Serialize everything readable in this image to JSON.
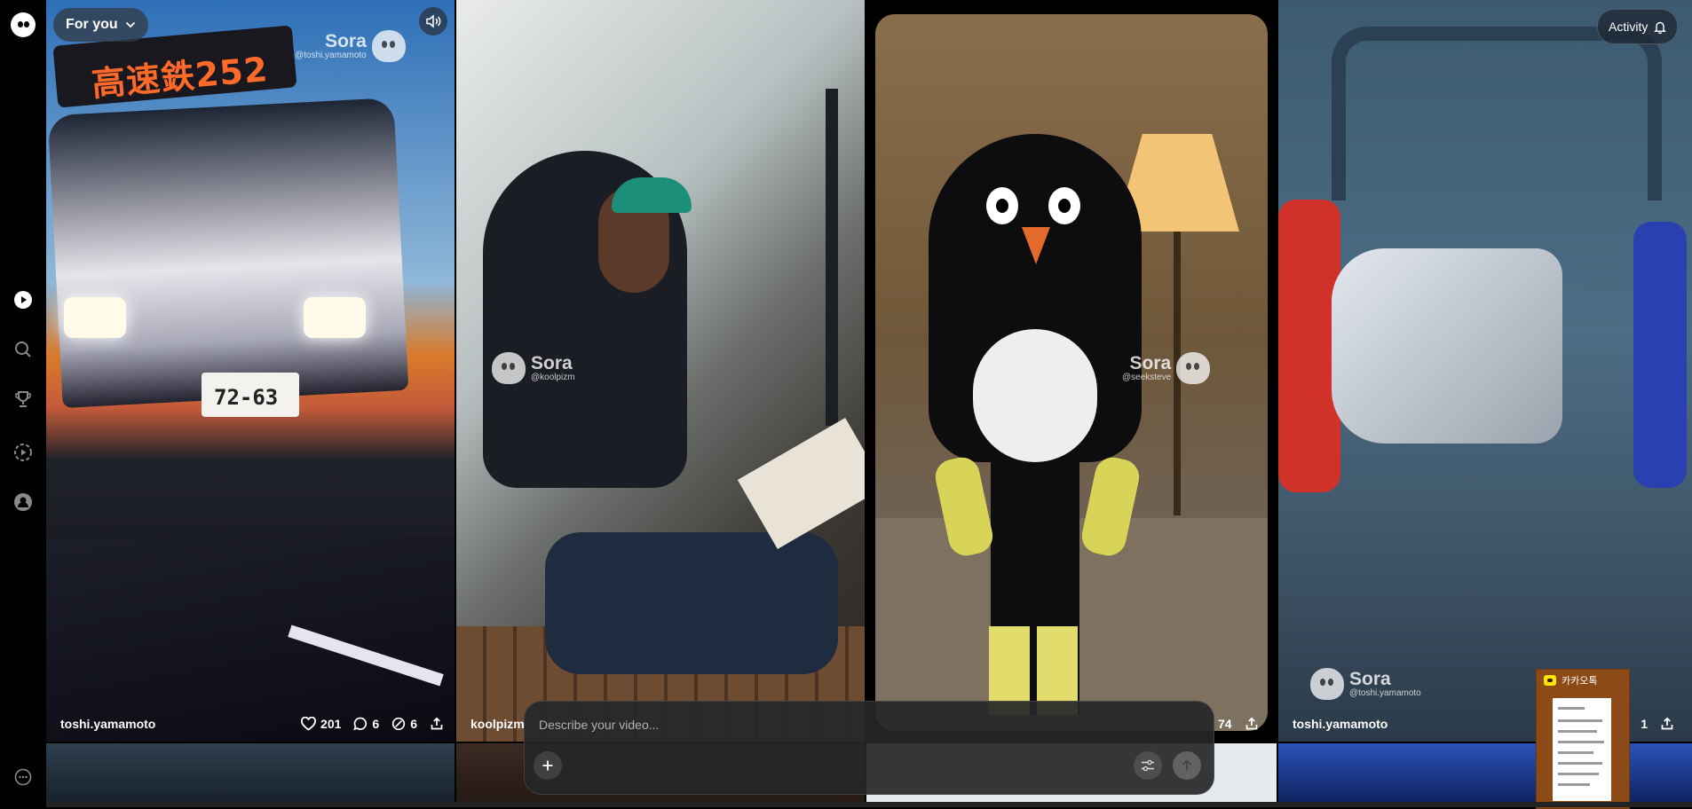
{
  "app": {
    "feed_selector": "For you",
    "activity_label": "Activity"
  },
  "sidebar": {
    "items": [
      {
        "icon": "sora-logo-icon"
      },
      {
        "icon": "feed-icon"
      },
      {
        "icon": "search-icon"
      },
      {
        "icon": "trophy-icon"
      },
      {
        "icon": "create-video-icon"
      },
      {
        "icon": "profile-icon"
      },
      {
        "icon": "more-icon"
      }
    ]
  },
  "videos": [
    {
      "watermark": {
        "name": "Sora",
        "handle": "@toshi.yamamoto"
      },
      "sign_text": "高速鉄252",
      "plate_text": "72-63",
      "user": "toshi.yamamoto",
      "likes": "201",
      "comments": "6",
      "remixes": "6"
    },
    {
      "watermark": {
        "name": "Sora",
        "handle": "@koolpizm"
      },
      "user": "koolpizm"
    },
    {
      "watermark": {
        "name": "Sora",
        "handle": "@seeksteve"
      },
      "remixes": "74"
    },
    {
      "watermark": {
        "name": "Sora",
        "handle": "@toshi.yamamoto"
      },
      "user": "toshi.yamamoto",
      "remixes": "1"
    }
  ],
  "composer": {
    "placeholder": "Describe your video..."
  },
  "kakao_popup": {
    "title": "카카오톡"
  },
  "colors": {
    "background": "#000000",
    "kakao_popup": "#8c4b16",
    "kakao_yellow": "#fee500"
  }
}
